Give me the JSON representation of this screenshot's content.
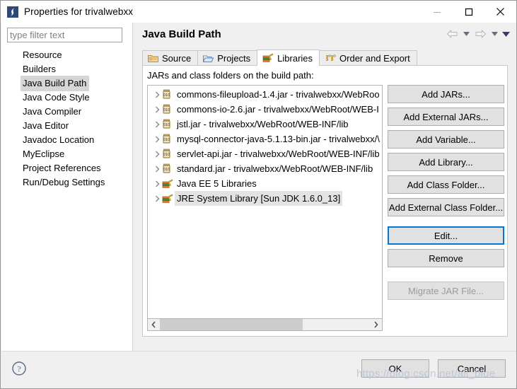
{
  "window": {
    "title": "Properties for trivalwebxx",
    "icon": "eclipse-properties-icon",
    "controls": {
      "minimize": "minimize-icon",
      "maximize": "maximize-icon",
      "close": "close-icon"
    }
  },
  "filter": {
    "placeholder": "type filter text",
    "value": ""
  },
  "sidebar": {
    "items": [
      {
        "label": "Resource",
        "selected": false
      },
      {
        "label": "Builders",
        "selected": false
      },
      {
        "label": "Java Build Path",
        "selected": true
      },
      {
        "label": "Java Code Style",
        "selected": false
      },
      {
        "label": "Java Compiler",
        "selected": false
      },
      {
        "label": "Java Editor",
        "selected": false
      },
      {
        "label": "Javadoc Location",
        "selected": false
      },
      {
        "label": "MyEclipse",
        "selected": false
      },
      {
        "label": "Project References",
        "selected": false
      },
      {
        "label": "Run/Debug Settings",
        "selected": false
      }
    ]
  },
  "page": {
    "title": "Java Build Path",
    "nav": {
      "back": "back-arrow-icon",
      "back_menu": "caret-down-icon",
      "forward": "forward-arrow-icon",
      "forward_menu": "caret-down-icon",
      "view_menu": "caret-down-filled-icon"
    }
  },
  "tabs": [
    {
      "label": "Source",
      "icon": "source-folder-icon",
      "active": false
    },
    {
      "label": "Projects",
      "icon": "open-folder-icon",
      "active": false
    },
    {
      "label": "Libraries",
      "icon": "books-icon",
      "active": true
    },
    {
      "label": "Order and Export",
      "icon": "order-export-icon",
      "active": false
    }
  ],
  "libraries": {
    "list_label": "JARs and class folders on the build path:",
    "entries": [
      {
        "label": "commons-fileupload-1.4.jar - trivalwebxx/WebRoo",
        "icon": "jar-icon",
        "selected": false,
        "expandable": true
      },
      {
        "label": "commons-io-2.6.jar - trivalwebxx/WebRoot/WEB-I",
        "icon": "jar-icon",
        "selected": false,
        "expandable": true
      },
      {
        "label": "jstl.jar - trivalwebxx/WebRoot/WEB-INF/lib",
        "icon": "jar-icon",
        "selected": false,
        "expandable": true
      },
      {
        "label": "mysql-connector-java-5.1.13-bin.jar - trivalwebxx/\\",
        "icon": "jar-icon",
        "selected": false,
        "expandable": true
      },
      {
        "label": "servlet-api.jar - trivalwebxx/WebRoot/WEB-INF/lib",
        "icon": "jar-icon",
        "selected": false,
        "expandable": true
      },
      {
        "label": "standard.jar - trivalwebxx/WebRoot/WEB-INF/lib",
        "icon": "jar-icon",
        "selected": false,
        "expandable": true
      },
      {
        "label": "Java EE 5 Libraries",
        "icon": "library-icon",
        "selected": false,
        "expandable": true
      },
      {
        "label": "JRE System Library [Sun JDK 1.6.0_13]",
        "icon": "library-icon",
        "selected": true,
        "expandable": true
      }
    ],
    "scrollbar": {
      "left_arrow": "chevron-left-icon",
      "right_arrow": "chevron-right-icon",
      "thumb_fraction": 0.68
    }
  },
  "buttons": [
    {
      "label": "Add JARs...",
      "state": "normal"
    },
    {
      "label": "Add External JARs...",
      "state": "normal"
    },
    {
      "label": "Add Variable...",
      "state": "normal"
    },
    {
      "label": "Add Library...",
      "state": "normal"
    },
    {
      "label": "Add Class Folder...",
      "state": "normal"
    },
    {
      "label": "Add External Class Folder...",
      "state": "normal"
    },
    {
      "label": "Edit...",
      "state": "focused"
    },
    {
      "label": "Remove",
      "state": "normal"
    },
    {
      "label": "Migrate JAR File...",
      "state": "disabled"
    }
  ],
  "footer": {
    "help": "help-circle-icon",
    "ok_label": "OK",
    "cancel_label": "Cancel"
  },
  "watermark": "https://blog.csdn.net/all_blue",
  "colors": {
    "accent": "#0078d7",
    "dialog_bg": "#f0f0f0",
    "button_face": "#e1e1e1",
    "selection": "#d6d6d6",
    "watermark": "#b9c4d6"
  }
}
